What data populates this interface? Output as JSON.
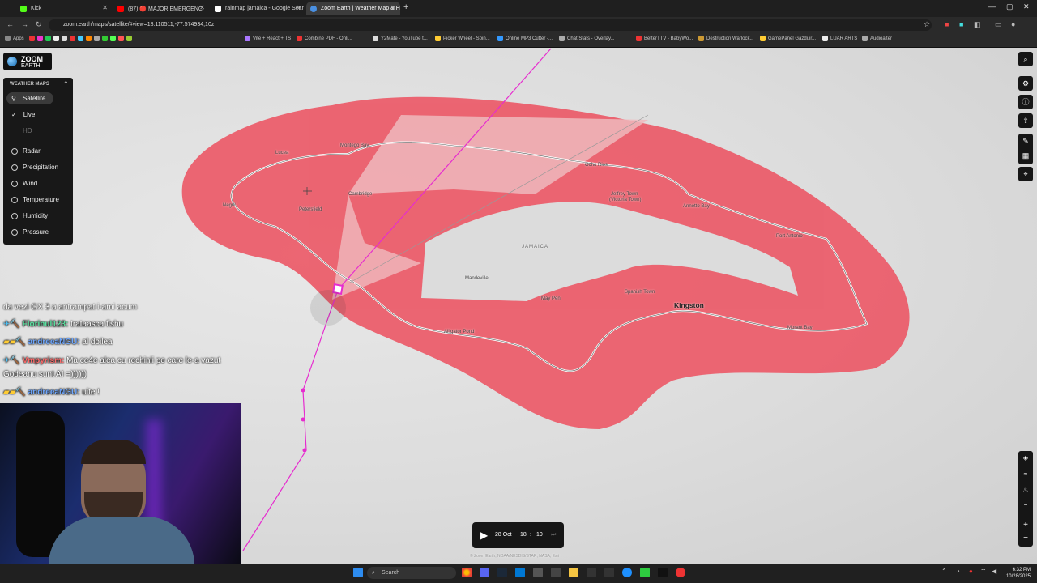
{
  "browser": {
    "tabs": [
      {
        "label": "Kick",
        "color": "#53fc18"
      },
      {
        "label": "(87) 🔴 MAJOR EMERGENC",
        "color": "#ff0000"
      },
      {
        "label": "rainmap jamaica - Google Sear",
        "color": "#ffffff"
      },
      {
        "label": "Zoom Earth | Weather Map & H",
        "color": "#4a90e2"
      }
    ],
    "url": "zoom.earth/maps/satellite/#view=18.110511,-77.574934,10z",
    "bookmarks": [
      "Apps",
      "Vite + React + TS",
      "Combine PDF - Onli...",
      "Y2Mate - YouTube t...",
      "Picker Wheel - Spin...",
      "Online MP3 Cutter -...",
      "Chat Stats - Overlay...",
      "BetterTTV - BabyWo...",
      "Destruction Warlock...",
      "GamePanel Gazduir...",
      "LUAR ARTS",
      "Audioalter"
    ]
  },
  "app": {
    "logo_line1": "ZOOM",
    "logo_line2": "EARTH",
    "panel_title": "WEATHER MAPS",
    "satellite": "Satellite",
    "live": "Live",
    "hd": "HD",
    "layers": [
      "Radar",
      "Precipitation",
      "Wind",
      "Temperature",
      "Humidity",
      "Pressure"
    ]
  },
  "map": {
    "country": "JAMAICA",
    "places": [
      {
        "name": "Montego Bay"
      },
      {
        "name": "Lucea"
      },
      {
        "name": "Negril"
      },
      {
        "name": "Petersfield"
      },
      {
        "name": "Cambridge"
      },
      {
        "name": "Ocho Rios"
      },
      {
        "name": "Jeffrey Town"
      },
      {
        "name": "(Victoria Town)"
      },
      {
        "name": "Annotto Bay"
      },
      {
        "name": "Port Antonio"
      },
      {
        "name": "Mandeville"
      },
      {
        "name": "May Pen"
      },
      {
        "name": "Spanish Town"
      },
      {
        "name": "Kingston"
      },
      {
        "name": "Morant Bay"
      },
      {
        "name": "Alligator Pond"
      }
    ],
    "attribution": "© Zoom Earth, NOAA/NESDIS/STAR, NASA, Esri"
  },
  "chat": [
    {
      "user": "",
      "text": "da vezi GX 3 a antrampat i-ami acum"
    },
    {
      "user": "Florinul123:",
      "text": "trataasca fishu",
      "color": "#5be0a0"
    },
    {
      "user": "andreeaNGU:",
      "text": "al doilea",
      "color": "#6fa8ff"
    },
    {
      "user": "Vmpyrism:",
      "text": "Ma ce4e alea cu rechinii pe care le-a vazut",
      "color": "#ff6b6b"
    },
    {
      "user": "",
      "text": "Godeanu sunt AI =))))))"
    },
    {
      "user": "andreeaNGU:",
      "text": "uite !",
      "color": "#6fa8ff"
    }
  ],
  "timeline": {
    "date": "28 Oct",
    "hour": "18",
    "minute": "10"
  },
  "taskbar": {
    "search": "Search",
    "time": "6:32 PM",
    "date": "10/28/2025"
  }
}
